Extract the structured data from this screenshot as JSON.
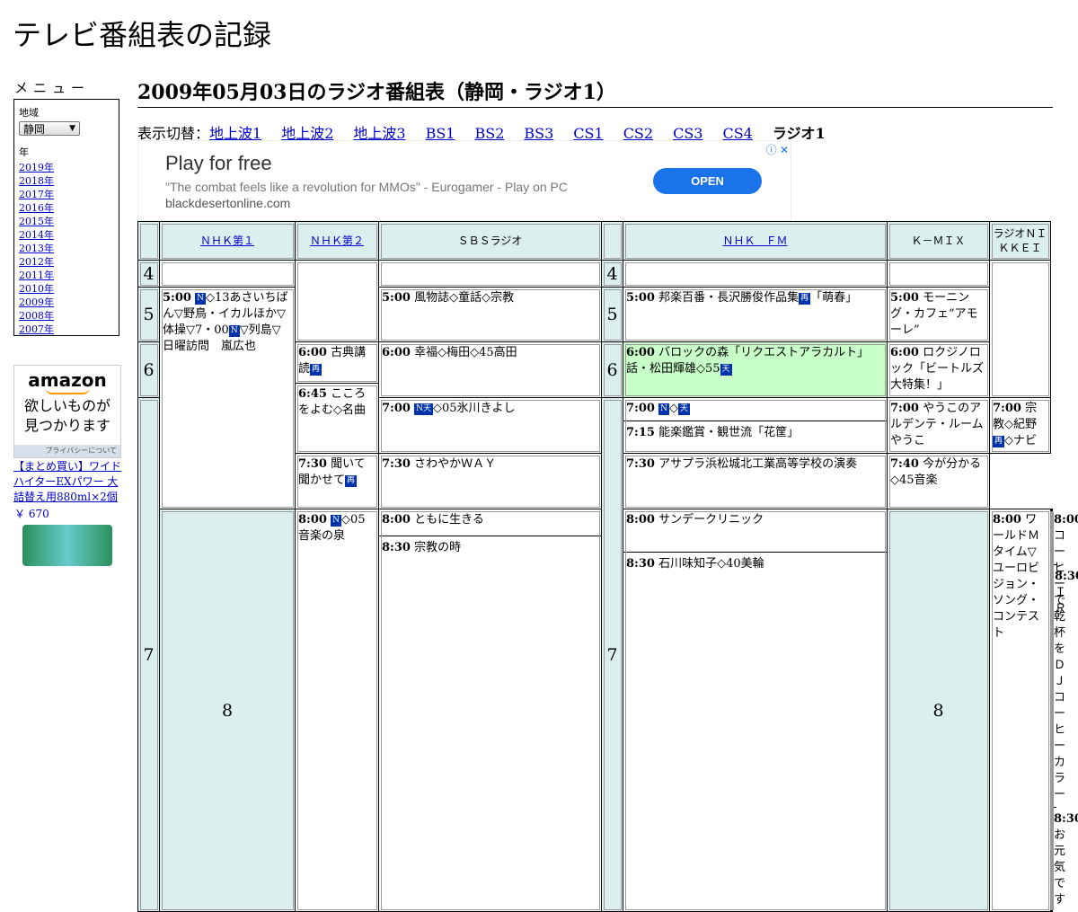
{
  "site_title": "テレビ番組表の記録",
  "menu": {
    "title": "メニュー",
    "region_label": "地域",
    "region_value": "静岡",
    "year_label": "年",
    "years": [
      "2019年",
      "2018年",
      "2017年",
      "2016年",
      "2015年",
      "2014年",
      "2013年",
      "2012年",
      "2011年",
      "2010年",
      "2009年",
      "2008年",
      "2007年"
    ]
  },
  "amazon_ad": {
    "logo": "amazon",
    "line1": "欲しいものが",
    "line2": "見つかります",
    "privacy": "プライバシーについて",
    "product": "【まとめ買い】ワイドハイターEXパワー 大詰替え用880ml×2個",
    "price": "￥ 670"
  },
  "page_title": "2009年05月03日のラジオ番組表（静岡・ラジオ1）",
  "switcher": {
    "label": "表示切替：",
    "links": [
      "地上波1",
      "地上波2",
      "地上波3",
      "BS1",
      "BS2",
      "BS3",
      "CS1",
      "CS2",
      "CS3",
      "CS4"
    ],
    "current": "ラジオ1"
  },
  "banner_ad": {
    "headline": "Play for free",
    "quote": "\"The combat feels like a revolution for MMOs\" - Eurogamer - Play on PC",
    "domain": "blackdesertonline.com",
    "button": "OPEN",
    "icons": "ⓘ ✕"
  },
  "channels": [
    "ＮＨＫ第１",
    "ＮＨＫ第２",
    "ＳＢＳラジオ",
    "ＮＨＫ　ＦＭ",
    "Ｋ－ＭＩＸ",
    "ラジオＮＩＫＫＥＩ"
  ],
  "hours": [
    "4",
    "5",
    "6",
    "7",
    "8"
  ],
  "programs": {
    "n1_500_time": "5:00",
    "n1_500_text": "◇13あさいちばん▽野鳥・イカルほか▽体操▽7・00",
    "n1_500_text2": "▽列島▽日曜訪問　嵐広也",
    "n1_800_time": "8:00",
    "n1_800_text": "◇05音楽の泉",
    "n2_600_time": "6:00",
    "n2_600_text": "古典講読",
    "n2_645_time": "6:45",
    "n2_645_text": "こころをよむ◇名曲",
    "n2_730_time": "7:30",
    "n2_730_text": "聞いて聞かせて",
    "n2_800_time": "8:00",
    "n2_800_text": "ともに生きる",
    "n2_830_time": "8:30",
    "n2_830_text": "宗教の時",
    "sbs_500_time": "5:00",
    "sbs_500_text": "風物誌◇童話◇宗教",
    "sbs_600_time": "6:00",
    "sbs_600_text": "幸福◇梅田◇45高田",
    "sbs_700_time": "7:00",
    "sbs_700_text": "◇05氷川きよし",
    "sbs_730_time": "7:30",
    "sbs_730_text": "さわやかＷＡＹ",
    "sbs_800_time": "8:00",
    "sbs_800_text": "サンデークリニック",
    "sbs_830_time": "8:30",
    "sbs_830_text": "石川味知子◇40美輪",
    "fm_500_time": "5:00",
    "fm_500_text": "邦楽百番・長沢勝俊作品集",
    "fm_500_text2": "「萌春」",
    "fm_600_time": "6:00",
    "fm_600_text": "バロックの森「リクエストアラカルト」話・松田輝雄◇55",
    "fm_700_time": "7:00",
    "fm_700_text": "◇",
    "fm_715_time": "7:15",
    "fm_715_text": "能楽鑑賞・観世流「花筐」",
    "fm_800_time": "8:00",
    "fm_800_text": "ワールドＭタイム▽ユーロビジョン・ソング・コンテスト",
    "km_500_time": "5:00",
    "km_500_text": "モーニング・カフェ“アモーレ”",
    "km_600_time": "6:00",
    "km_600_text": "ロクジノロック「ビートルズ大特集！」",
    "km_700_time": "7:00",
    "km_700_text": "やうこのアルデンテ・ルームやうこ",
    "km_730_time": "7:30",
    "km_730_text": "アサプラ浜松城北工業高等学校の演奏",
    "km_800_time": "8:00",
    "km_800_text": "コーヒーで乾杯をＤＪコーヒーカラー",
    "km_830_time": "8:30",
    "km_830_text": "お元気です",
    "nk_700_time": "7:00",
    "nk_700_text": "宗教◇紀野",
    "nk_700_text2": "◇ナビ",
    "nk_740_time": "7:40",
    "nk_740_text": "今が分かる◇45音楽",
    "nk_830_time": "8:30",
    "nk_830_text": "ＩＲ"
  },
  "badges": {
    "n": "N",
    "ten": "天",
    "sai": "再",
    "n_ten": "N天"
  }
}
